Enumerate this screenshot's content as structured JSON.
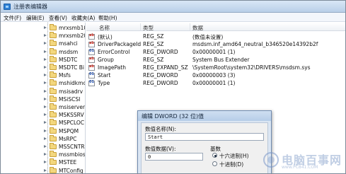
{
  "window": {
    "title": "注册表编辑器"
  },
  "menu": [
    "文件(F)",
    "编辑(E)",
    "查看(V)",
    "收藏夹(A)",
    "帮助(H)"
  ],
  "tree": {
    "items": [
      "mrxsmb10",
      "mrxsmb20",
      "msahci",
      "msdsm",
      "MSDTC",
      "MSDTC Bi",
      "Msfs",
      "mshidkmc",
      "msisadrv",
      "MSiSCSI",
      "msiserver",
      "MSKSSRV",
      "MSPCLOC",
      "MSPQM",
      "MsRPC",
      "MSSCNTR",
      "mssmbios",
      "MSTEE",
      "MTConfig"
    ]
  },
  "list": {
    "columns": {
      "name": "名称",
      "type": "类型",
      "data": "数据"
    },
    "rows": [
      {
        "name": "(默认)",
        "type": "REG_SZ",
        "data": "(数值未设置)",
        "kind": "str"
      },
      {
        "name": "DriverPackageId",
        "type": "REG_SZ",
        "data": "msdsm.inf_amd64_neutral_b346520e14392b2f",
        "kind": "str"
      },
      {
        "name": "ErrorControl",
        "type": "REG_DWORD",
        "data": "0x00000001 (1)",
        "kind": "num"
      },
      {
        "name": "Group",
        "type": "REG_SZ",
        "data": "System Bus Extender",
        "kind": "str"
      },
      {
        "name": "ImagePath",
        "type": "REG_EXPAND_SZ",
        "data": "\\SystemRoot\\system32\\DRIVERS\\msdsm.sys",
        "kind": "str"
      },
      {
        "name": "Start",
        "type": "REG_DWORD",
        "data": "0x00000003 (3)",
        "kind": "num"
      },
      {
        "name": "Type",
        "type": "REG_DWORD",
        "data": "0x00000001 (1)",
        "kind": "num"
      }
    ]
  },
  "dialog": {
    "title": "编辑 DWORD (32 位)值",
    "name_label": "数值名称(N):",
    "name_value": "Start",
    "data_label": "数值数据(V):",
    "data_value": "0",
    "base_label": "基数",
    "base_options": [
      "十六进制(H)",
      "十进制(D)"
    ],
    "base_selected": 0
  },
  "watermark": {
    "text": "电脑百事网",
    "url": "www.PC841.COM"
  }
}
